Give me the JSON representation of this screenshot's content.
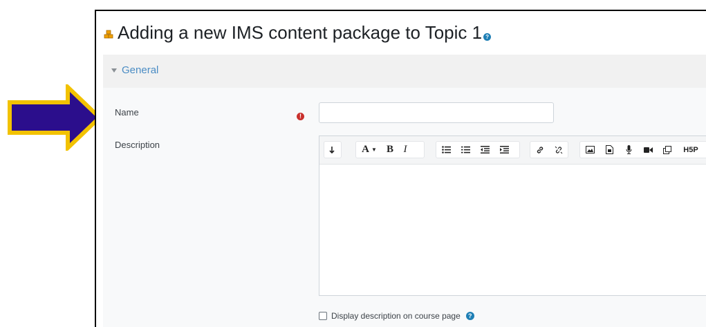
{
  "page": {
    "title": "Adding a new IMS content package to Topic 1",
    "help_icon": "help-icon"
  },
  "section": {
    "label": "General",
    "expanded": true
  },
  "fields": {
    "name_label": "Name",
    "name_value": "",
    "required_icon": "exclamation-circle-icon",
    "description_label": "Description"
  },
  "toolbar": {
    "groups": [
      [
        "collapse-icon"
      ],
      [
        "font-color-icon",
        "bold-icon",
        "italic-icon"
      ],
      [
        "unordered-list-icon",
        "ordered-list-icon",
        "outdent-icon",
        "indent-icon"
      ],
      [
        "link-icon",
        "unlink-icon"
      ],
      [
        "image-icon",
        "media-icon",
        "record-audio-icon",
        "record-video-icon",
        "manage-files-icon",
        "h5p-icon"
      ]
    ],
    "font_color_label": "A",
    "bold_label": "B",
    "italic_label": "I",
    "h5p_label": "H5P"
  },
  "display_description": {
    "label": "Display description on course page",
    "checked": false
  },
  "colors": {
    "arrow_fill": "#2b0e8c",
    "arrow_stroke": "#f2c200",
    "section_link": "#4a8cc4",
    "required": "#c9302c",
    "help": "#1f7fb5"
  }
}
